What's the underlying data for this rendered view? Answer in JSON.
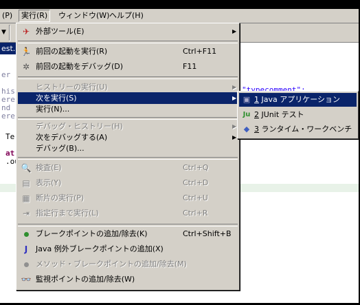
{
  "menubar": {
    "items": [
      {
        "label": "(P)"
      },
      {
        "label": "実行(R)"
      },
      {
        "label": "ウィンドウ(W)"
      },
      {
        "label": "ヘルプ(H)"
      }
    ]
  },
  "editor": {
    "tab_label": "est.",
    "left_fragments": [
      "er",
      "his",
      "ere",
      "nd",
      "ere",
      "Te",
      "at",
      ".ou"
    ],
    "right_text": "\"typecomment\":"
  },
  "run_menu": {
    "items": [
      {
        "label": "外部ツール(E)",
        "accel": "",
        "icon": "external-tools-icon",
        "has_submenu": true,
        "disabled": false
      },
      {
        "label": "前回の起動を実行(R)",
        "accel": "Ctrl+F11",
        "icon": "run-icon",
        "disabled": false
      },
      {
        "label": "前回の起動をデバッグ(D)",
        "accel": "F11",
        "icon": "debug-icon",
        "disabled": false
      },
      {
        "label": "ヒストリーの実行(U)",
        "accel": "",
        "has_submenu": true,
        "disabled": true
      },
      {
        "label": "次を実行(S)",
        "accel": "",
        "has_submenu": true,
        "disabled": false,
        "selected": true
      },
      {
        "label": "実行(N)...",
        "accel": "",
        "disabled": false
      },
      {
        "label": "デバッグ・ヒストリー(H)",
        "accel": "",
        "has_submenu": true,
        "disabled": true
      },
      {
        "label": "次をデバッグする(A)",
        "accel": "",
        "has_submenu": true,
        "disabled": false
      },
      {
        "label": "デバッグ(B)...",
        "accel": "",
        "disabled": false
      },
      {
        "label": "検査(E)",
        "accel": "Ctrl+Q",
        "icon": "inspect-icon",
        "disabled": true
      },
      {
        "label": "表示(Y)",
        "accel": "Ctrl+D",
        "icon": "display-icon",
        "disabled": true
      },
      {
        "label": "断片の実行(P)",
        "accel": "Ctrl+U",
        "icon": "execute-icon",
        "disabled": true
      },
      {
        "label": "指定行まで実行(L)",
        "accel": "Ctrl+R",
        "icon": "run-to-line-icon",
        "disabled": true
      },
      {
        "label": "ブレークポイントの追加/除去(K)",
        "accel": "Ctrl+Shift+B",
        "icon": "breakpoint-icon",
        "disabled": false
      },
      {
        "label": "Java 例外ブレークポイントの追加(X)",
        "accel": "",
        "icon": "java-exception-icon",
        "disabled": false
      },
      {
        "label": "メソッド・ブレークポイントの追加/除去(M)",
        "accel": "",
        "icon": "method-breakpoint-icon",
        "disabled": true
      },
      {
        "label": "監視ポイントの追加/除去(W)",
        "accel": "",
        "icon": "watchpoint-icon",
        "disabled": false
      }
    ]
  },
  "run_as_submenu": {
    "items": [
      {
        "num": "1",
        "label": " Java アプリケーション",
        "icon": "java-app-icon",
        "selected": true
      },
      {
        "num": "2",
        "label": " JUnit テスト",
        "icon": "junit-icon"
      },
      {
        "num": "3",
        "label": " ランタイム・ワークベンチ",
        "icon": "workbench-icon"
      }
    ]
  },
  "colors": {
    "menu_bg": "#d4d0c8",
    "selection": "#0a246a",
    "disabled_text": "#808080"
  }
}
